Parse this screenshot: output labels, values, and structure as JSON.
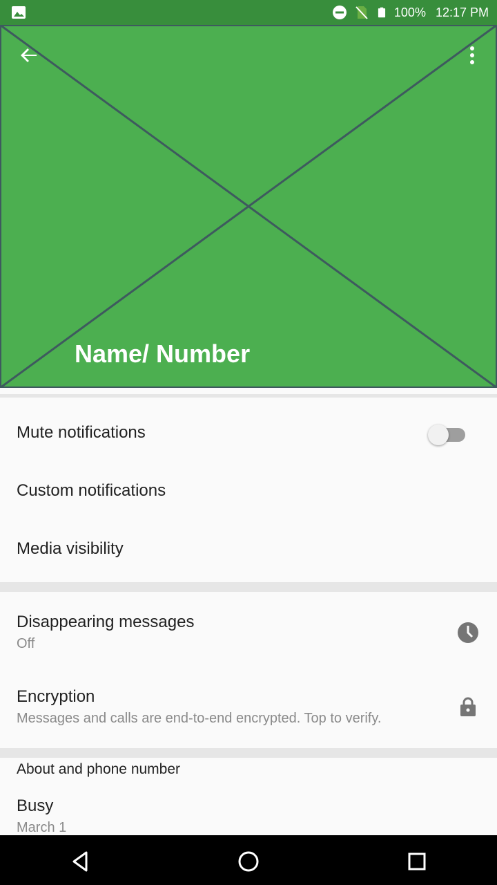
{
  "status_bar": {
    "battery": "100%",
    "time": "12:17 PM",
    "icons": [
      "image-icon",
      "dnd-icon",
      "no-sim-icon",
      "battery-icon"
    ]
  },
  "header": {
    "title": "Name/ Number",
    "background_color": "#4caf50",
    "back_icon": "arrow-back-icon",
    "menu_icon": "more-vert-icon"
  },
  "settings": {
    "mute_notifications": {
      "label": "Mute notifications",
      "enabled": false
    },
    "custom_notifications": {
      "label": "Custom notifications"
    },
    "media_visibility": {
      "label": "Media visibility"
    },
    "disappearing_messages": {
      "label": "Disappearing messages",
      "value": "Off",
      "icon": "timer-icon"
    },
    "encryption": {
      "label": "Encryption",
      "description": "Messages and calls are end-to-end encrypted. Top to verify.",
      "icon": "lock-icon"
    }
  },
  "about": {
    "section_title": "About and phone number",
    "status": "Busy",
    "date": "March 1"
  },
  "nav_bar": {
    "icons": [
      "back-triangle-icon",
      "home-circle-icon",
      "recents-square-icon"
    ]
  },
  "colors": {
    "status_bar": "#388e3c",
    "header": "#4caf50",
    "cross_lines": "#3e5a5e"
  }
}
